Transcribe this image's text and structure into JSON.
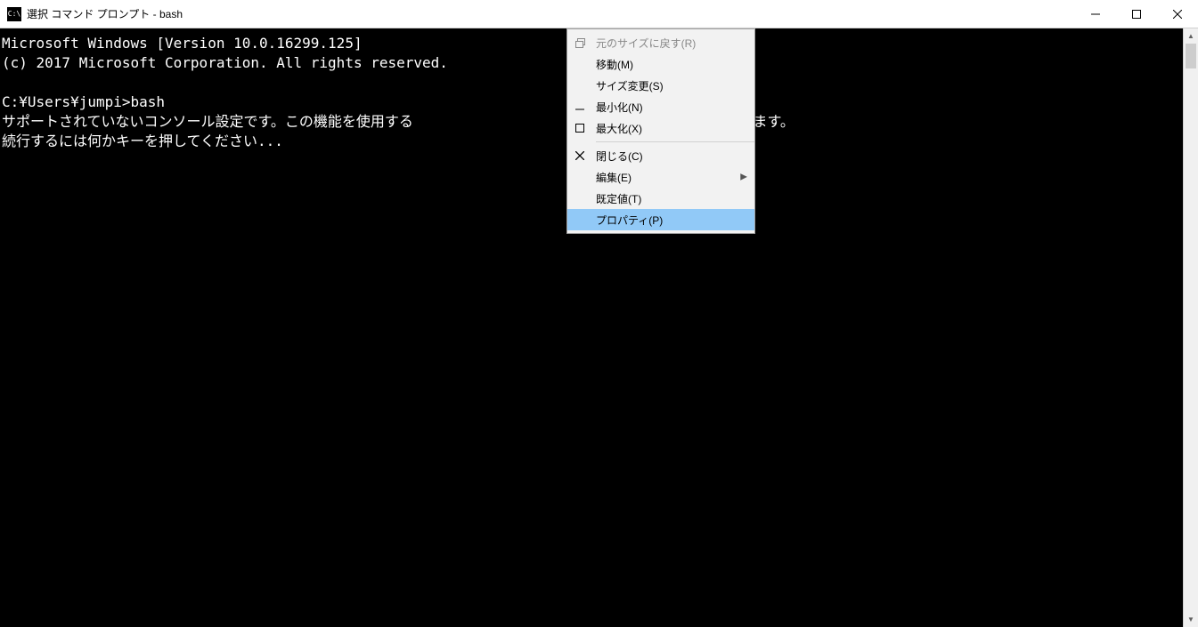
{
  "window": {
    "icon_text": "C:\\",
    "title": "選択 コマンド プロンプト - bash"
  },
  "terminal": {
    "text": "Microsoft Windows [Version 10.0.16299.125]\n(c) 2017 Microsoft Corporation. All rights reserved.\n\nC:¥Users¥jumpi>bash\nサポートされていないコンソール設定です。この機能を使用する                  ールを無効にする必要があります。\n続行するには何かキーを押してください..."
  },
  "context_menu": {
    "restore": "元のサイズに戻す(R)",
    "move": "移動(M)",
    "size": "サイズ変更(S)",
    "minimize": "最小化(N)",
    "maximize": "最大化(X)",
    "close": "閉じる(C)",
    "edit": "編集(E)",
    "defaults": "既定値(T)",
    "properties": "プロパティ(P)"
  }
}
